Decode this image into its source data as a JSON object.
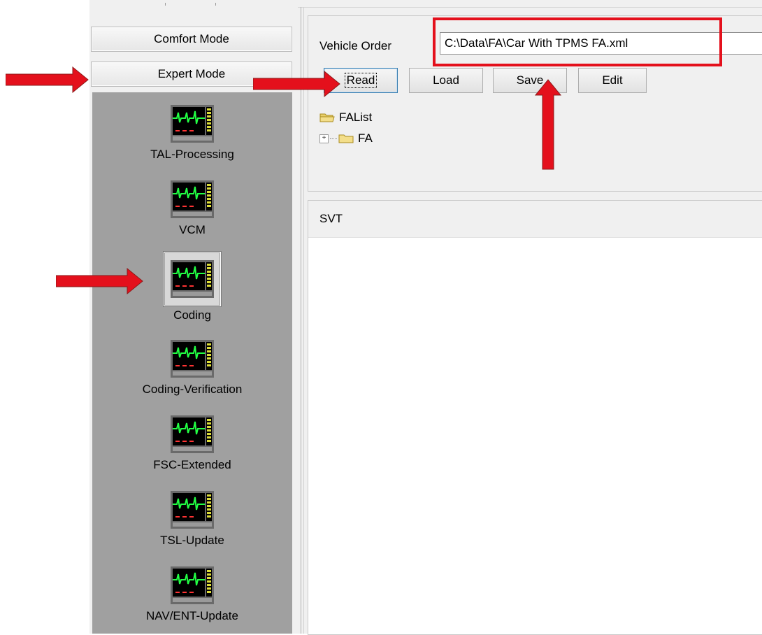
{
  "left_panel": {
    "modes": [
      "Comfort Mode",
      "Expert Mode"
    ],
    "tools": [
      "TAL-Processing",
      "VCM",
      "Coding",
      "Coding-Verification",
      "FSC-Extended",
      "TSL-Update",
      "NAV/ENT-Update"
    ],
    "selected_tool": "Coding",
    "tool_icon": "monitor-waveform-icon"
  },
  "vehicle_order": {
    "label": "Vehicle Order",
    "path_value": "C:\\Data\\FA\\Car With TPMS FA.xml",
    "buttons": {
      "read": "Read",
      "load": "Load",
      "save": "Save",
      "edit": "Edit"
    },
    "tree": {
      "root": "FAList",
      "child": "FA"
    }
  },
  "svt": {
    "title": "SVT"
  },
  "annotations": {
    "highlight_color": "#e4101c",
    "arrow_color": "#e4101c"
  }
}
